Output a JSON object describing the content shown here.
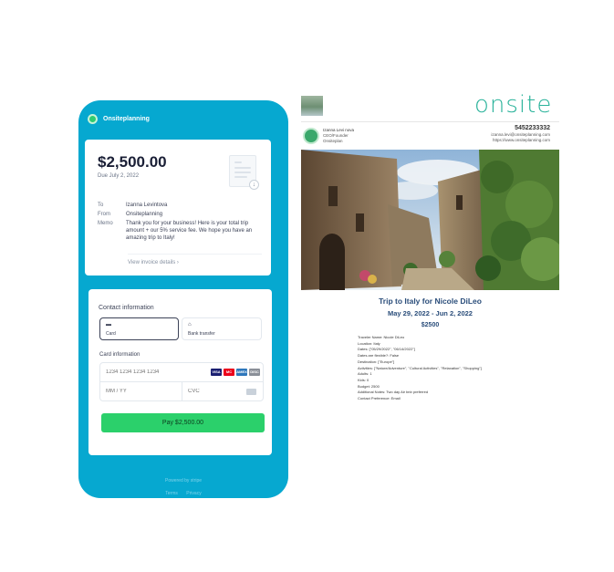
{
  "checkout": {
    "merchant": "Onsiteplanning",
    "amount": "$2,500.00",
    "due": "Due July 2, 2022",
    "to_label": "To",
    "to_value": "Izanna Levintova",
    "from_label": "From",
    "from_value": "Onsiteplanning",
    "memo_label": "Memo",
    "memo_value": "Thank you for your business! Here is your total trip amount + our 5% service fee. We hope you have an amazing trip to Italy!",
    "view_details": "View invoice details ›",
    "contact_title": "Contact information",
    "tab_card": "Card",
    "tab_bank": "Bank transfer",
    "card_info_label": "Card information",
    "card_number_placeholder": "1234 1234 1234 1234",
    "expiry_placeholder": "MM / YY",
    "cvc_placeholder": "CVC",
    "card_brands": [
      {
        "name": "VISA",
        "color": "#1a1f71"
      },
      {
        "name": "MC",
        "color": "#eb001b"
      },
      {
        "name": "AMEX",
        "color": "#2e77bb"
      },
      {
        "name": "DISC",
        "color": "#8a8f98"
      }
    ],
    "pay_button": "Pay $2,500.00",
    "powered_by": "Powered by stripe",
    "footer_terms": "Terms",
    "footer_privacy": "Privacy"
  },
  "itinerary": {
    "logo": "onsite",
    "author_name": "Izanna Levi nova",
    "author_role": "CEO/Founder",
    "author_company": "Onsiteplan",
    "phone": "5452233332",
    "email": "izanna.levi@onsiteplanning.com",
    "website": "https://www.onsiteplanning.com",
    "title": "Trip to Italy for Nicole DiLeo",
    "dates": "May 29, 2022 - Jun 2, 2022",
    "price": "$2500",
    "details": [
      "Traveler Name: Nicole DiLeo",
      "Location: Italy",
      "Dates: [\"05/29/2022\", \"06/14/2022\"]",
      "Dates are flexible?: False",
      "Destination: [\"Europe\"]",
      "Activities: [\"Nature/Adventure\", \"Cultural Activities\", \"Relaxation\", \"Shopping\"]",
      "Adults: 1",
      "Kids: 0",
      "Budget: 2500",
      "Additional Notes: Two day Air bnb preferred",
      "Contact Preference: Email"
    ]
  }
}
